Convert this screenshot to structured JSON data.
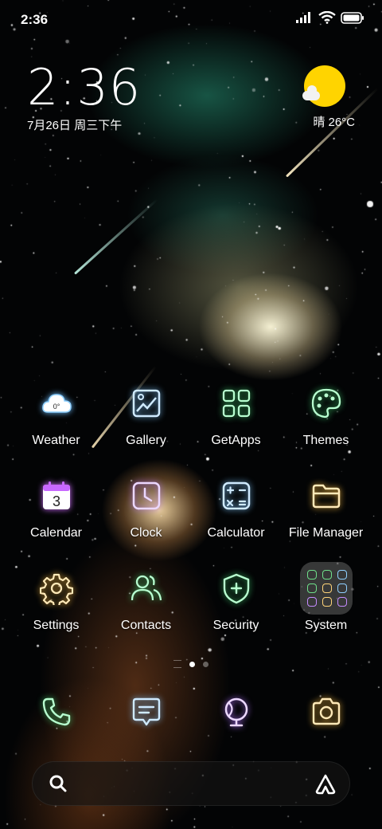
{
  "status_bar": {
    "time": "2:36"
  },
  "clock_widget": {
    "time": "2:36",
    "date": "7月26日 周三下午"
  },
  "weather_widget": {
    "text": "晴 26°C"
  },
  "apps": [
    {
      "label": "Weather",
      "icon": "weather-icon",
      "badge": "0°",
      "color": "#8fd0ff"
    },
    {
      "label": "Gallery",
      "icon": "gallery-icon",
      "color": "#9fd4ff"
    },
    {
      "label": "GetApps",
      "icon": "getapps-icon",
      "color": "#5fe08a"
    },
    {
      "label": "Themes",
      "icon": "themes-icon",
      "color": "#5fe08a"
    },
    {
      "label": "Calendar",
      "icon": "calendar-icon",
      "badge": "3",
      "color": "#e68cff"
    },
    {
      "label": "Clock",
      "icon": "clock-icon",
      "color": "#c58cff"
    },
    {
      "label": "Calculator",
      "icon": "calculator-icon",
      "color": "#9fd4ff"
    },
    {
      "label": "File Manager",
      "icon": "folder-icon",
      "color": "#ffd47a"
    },
    {
      "label": "Settings",
      "icon": "settings-icon",
      "color": "#ffd47a"
    },
    {
      "label": "Contacts",
      "icon": "contacts-icon",
      "color": "#5fe08a"
    },
    {
      "label": "Security",
      "icon": "security-icon",
      "color": "#5fe08a"
    },
    {
      "label": "System",
      "icon": "system-folder-icon",
      "color": "#ffffff"
    }
  ],
  "dock": [
    {
      "icon": "phone-icon",
      "color": "#5fe08a"
    },
    {
      "icon": "messages-icon",
      "color": "#9fd4ff"
    },
    {
      "icon": "browser-icon",
      "color": "#c58cff"
    },
    {
      "icon": "camera-icon",
      "color": "#ffd47a"
    }
  ],
  "search_bar": {
    "left_icon": "search-icon",
    "right_icon": "assistant-icon"
  }
}
